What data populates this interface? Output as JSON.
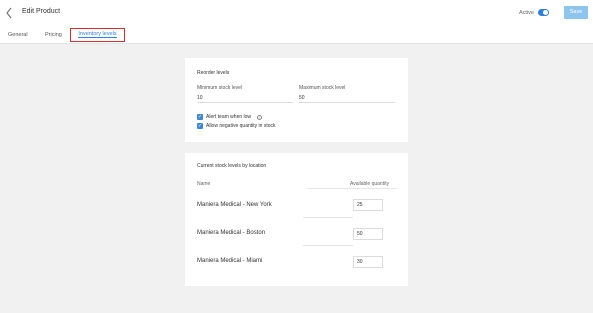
{
  "header": {
    "back_icon": "chevron-left-icon",
    "title": "Edit Product",
    "active_label": "Active",
    "active_on": true,
    "save_label": "Save"
  },
  "tabs": [
    {
      "label": "General"
    },
    {
      "label": "Pricing"
    },
    {
      "label": "Inventory levels",
      "selected": true
    }
  ],
  "reorder": {
    "title": "Reorder levels",
    "min_label": "Minimum stock level",
    "min_value": "10",
    "max_label": "Maximum stock level",
    "max_value": "50",
    "alert_label": "Alert team when low",
    "alert_checked": true,
    "negative_label": "Allow negative quantity in stock",
    "negative_checked": true
  },
  "stock": {
    "title": "Current stock levels by location",
    "col_name": "Name",
    "col_qty": "Available quantity",
    "rows": [
      {
        "name": "Maniera Medical - New York",
        "qty": "25"
      },
      {
        "name": "Maniera Medical - Boston",
        "qty": "50"
      },
      {
        "name": "Maniera Medical - Miami",
        "qty": "30"
      }
    ]
  },
  "colors": {
    "accent": "#2d7fe0",
    "save_button": "#8ec5ef",
    "highlight_border": "#d32f2f"
  }
}
